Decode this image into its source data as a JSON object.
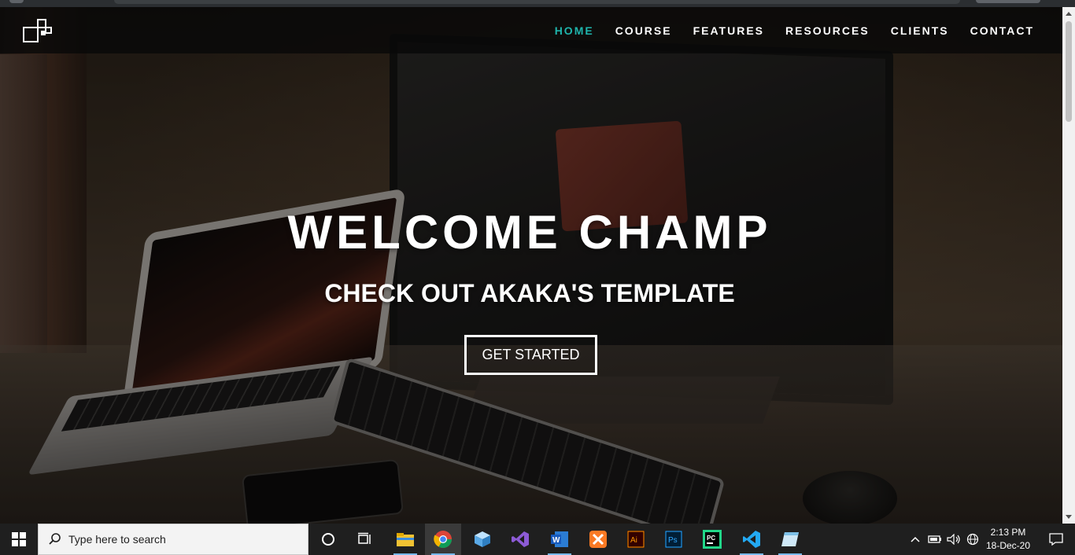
{
  "nav": {
    "items": [
      {
        "label": "HOME",
        "active": true
      },
      {
        "label": "COURSE",
        "active": false
      },
      {
        "label": "FEATURES",
        "active": false
      },
      {
        "label": "RESOURCES",
        "active": false
      },
      {
        "label": "CLIENTS",
        "active": false
      },
      {
        "label": "CONTACT",
        "active": false
      }
    ],
    "active_color": "#1fb5ac"
  },
  "hero": {
    "title": "WELCOME CHAMP",
    "subtitle": "CHECK OUT AKAKA'S TEMPLATE",
    "cta_label": "GET STARTED"
  },
  "taskbar": {
    "search_placeholder": "Type here to search",
    "apps": [
      "file-explorer-icon",
      "chrome-icon",
      "box-app-icon",
      "visual-studio-icon",
      "word-icon",
      "xampp-icon",
      "illustrator-icon",
      "photoshop-icon",
      "pycharm-icon",
      "vscode-icon",
      "notepad-app-icon"
    ],
    "time": "2:13 PM",
    "date": "18-Dec-20"
  }
}
